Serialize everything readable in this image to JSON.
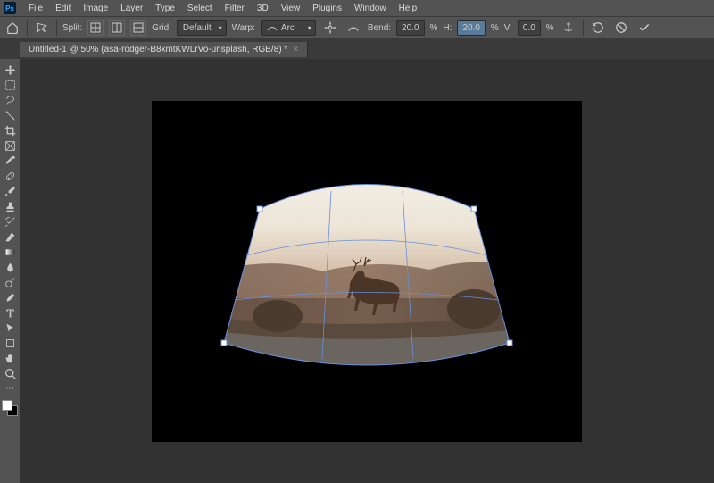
{
  "menu": {
    "items": [
      "File",
      "Edit",
      "Image",
      "Layer",
      "Type",
      "Select",
      "Filter",
      "3D",
      "View",
      "Plugins",
      "Window",
      "Help"
    ]
  },
  "options": {
    "split_label": "Split:",
    "grid_label": "Grid:",
    "grid_value": "Default",
    "warp_label": "Warp:",
    "warp_value": "Arc",
    "bend_label": "Bend:",
    "bend_value": "20.0",
    "pct1": "%",
    "h_label": "H:",
    "h_value": "20.0",
    "pct2": "%",
    "v_label": "V:",
    "v_value": "0.0",
    "pct3": "%"
  },
  "tab": {
    "title": "Untitled-1 @ 50% (asa-rodger-B8xmtKWLrVo-unsplash, RGB/8) *"
  }
}
